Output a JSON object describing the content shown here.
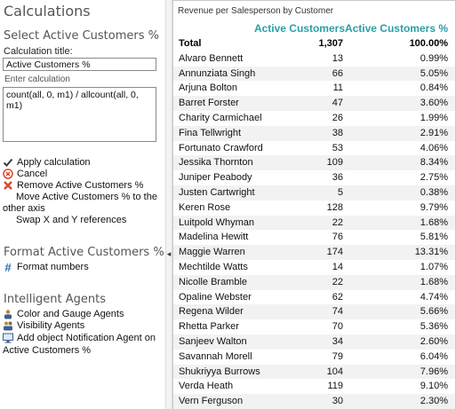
{
  "left": {
    "title": "Calculations",
    "section_select": "Select Active Customers %",
    "calc_title_label": "Calculation title:",
    "calc_title_value": "Active Customers %",
    "enter_calc_label": "Enter calculation",
    "calc_expression": "count(all, 0, m1) / allcount(all, 0, m1)",
    "actions": {
      "apply": "Apply calculation",
      "cancel": "Cancel",
      "remove": "Remove Active Customers %",
      "move_line1": "Move Active Customers % to the",
      "move_line2": "other axis",
      "swap": "Swap X and Y references"
    },
    "section_format": "Format Active Customers %",
    "format_numbers": "Format numbers",
    "section_agents": "Intelligent Agents",
    "agents": {
      "color_gauge": "Color and Gauge Agents",
      "visibility": "Visibility Agents",
      "notification_line1": "Add object Notification Agent on",
      "notification_line2": "Active Customers %"
    }
  },
  "table": {
    "title": "Revenue per Salesperson by Customer",
    "col1": "Active Customers",
    "col2": "Active Customers %",
    "total": {
      "name": "Total",
      "active": "1,307",
      "pct": "100.00%"
    },
    "rows": [
      {
        "name": "Alvaro Bennett",
        "active": "13",
        "pct": "0.99%"
      },
      {
        "name": "Annunziata Singh",
        "active": "66",
        "pct": "5.05%"
      },
      {
        "name": "Arjuna Bolton",
        "active": "11",
        "pct": "0.84%"
      },
      {
        "name": "Barret Forster",
        "active": "47",
        "pct": "3.60%"
      },
      {
        "name": "Charity Carmichael",
        "active": "26",
        "pct": "1.99%"
      },
      {
        "name": "Fina Tellwright",
        "active": "38",
        "pct": "2.91%"
      },
      {
        "name": "Fortunato Crawford",
        "active": "53",
        "pct": "4.06%"
      },
      {
        "name": "Jessika Thornton",
        "active": "109",
        "pct": "8.34%"
      },
      {
        "name": "Juniper Peabody",
        "active": "36",
        "pct": "2.75%"
      },
      {
        "name": "Justen Cartwright",
        "active": "5",
        "pct": "0.38%"
      },
      {
        "name": "Keren Rose",
        "active": "128",
        "pct": "9.79%"
      },
      {
        "name": "Luitpold Whyman",
        "active": "22",
        "pct": "1.68%"
      },
      {
        "name": "Madelina Hewitt",
        "active": "76",
        "pct": "5.81%"
      },
      {
        "name": "Maggie Warren",
        "active": "174",
        "pct": "13.31%"
      },
      {
        "name": "Mechtilde Watts",
        "active": "14",
        "pct": "1.07%"
      },
      {
        "name": "Nicolle Bramble",
        "active": "22",
        "pct": "1.68%"
      },
      {
        "name": "Opaline Webster",
        "active": "62",
        "pct": "4.74%"
      },
      {
        "name": "Regena Wilder",
        "active": "74",
        "pct": "5.66%"
      },
      {
        "name": "Rhetta Parker",
        "active": "70",
        "pct": "5.36%"
      },
      {
        "name": "Sanjeev Walton",
        "active": "34",
        "pct": "2.60%"
      },
      {
        "name": "Savannah Morell",
        "active": "79",
        "pct": "6.04%"
      },
      {
        "name": "Shukriyya Burrows",
        "active": "104",
        "pct": "7.96%"
      },
      {
        "name": "Verda Heath",
        "active": "119",
        "pct": "9.10%"
      },
      {
        "name": "Vern Ferguson",
        "active": "30",
        "pct": "2.30%"
      }
    ]
  },
  "colors": {
    "header_accent": "#2a9fa5",
    "apply_check": "#3a3a3a",
    "cancel_red": "#d9482b",
    "remove_red": "#d9482b",
    "format_blue": "#2b6cb0"
  },
  "icons": {
    "apply": "check-icon",
    "cancel": "cancel-circle-icon",
    "remove": "remove-x-icon",
    "format": "hash-format-icon",
    "color_gauge": "person-agent-icon",
    "visibility": "people-agent-icon",
    "notification": "monitor-agent-icon",
    "splitter": "collapse-left-arrow-icon"
  }
}
